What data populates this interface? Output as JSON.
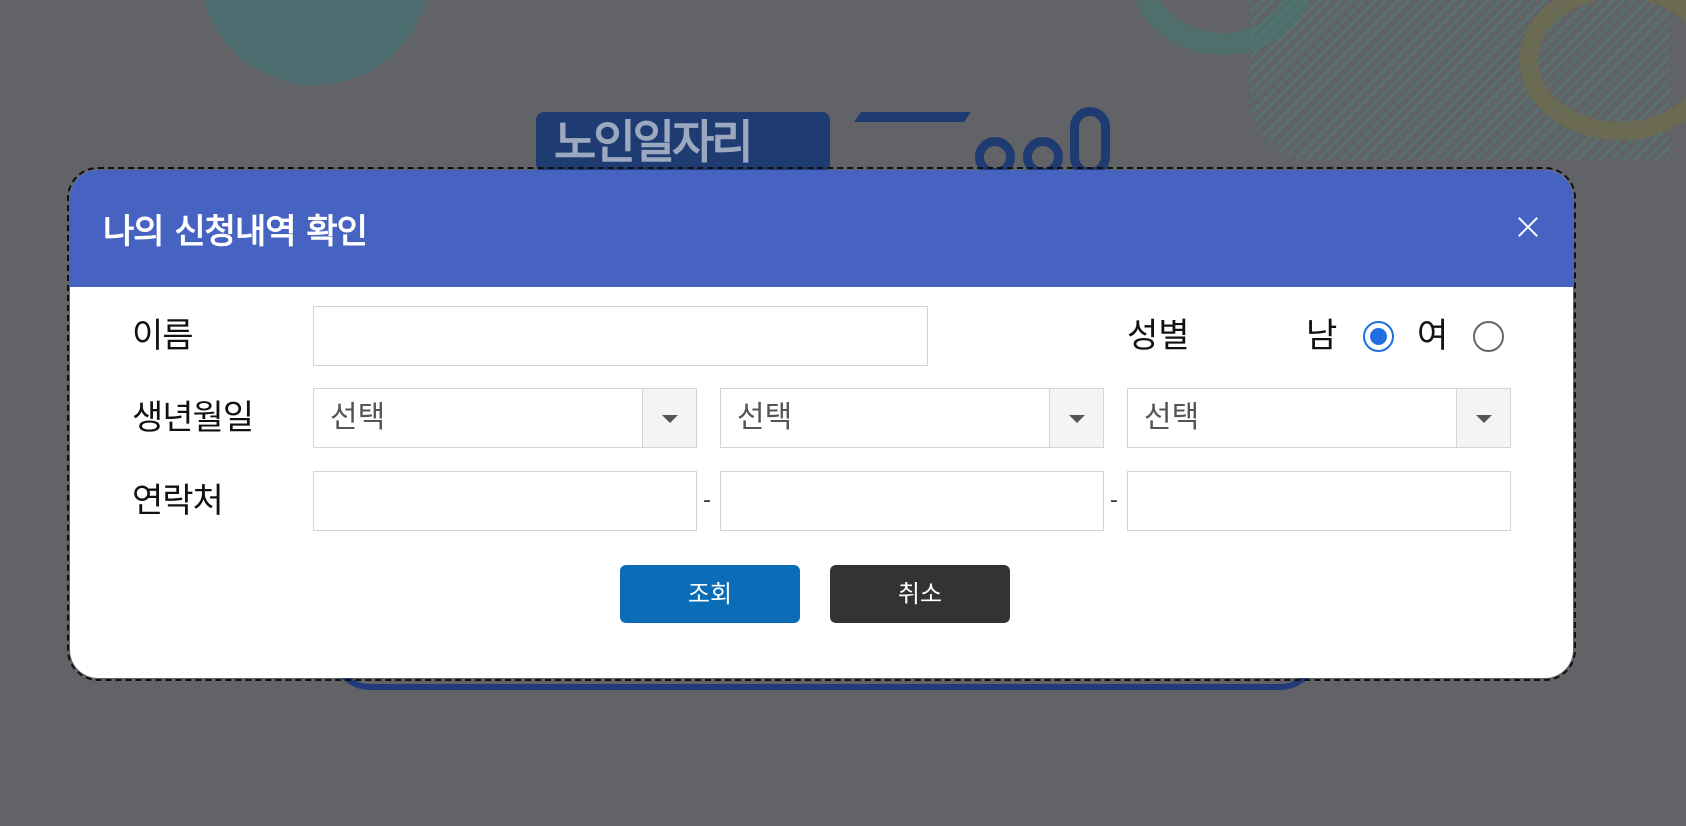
{
  "background": {
    "logo_text": "노인일자리"
  },
  "modal": {
    "title": "나의 신청내역 확인",
    "close_label": "닫기",
    "fields": {
      "name_label": "이름",
      "name_value": "",
      "gender_label": "성별",
      "gender_options": [
        {
          "label": "남",
          "checked": true
        },
        {
          "label": "여",
          "checked": false
        }
      ],
      "birth_label": "생년월일",
      "birth_selects": [
        {
          "value": "선택"
        },
        {
          "value": "선택"
        },
        {
          "value": "선택"
        }
      ],
      "phone_label": "연락처",
      "phone_values": [
        "",
        "",
        ""
      ],
      "phone_separator": "-"
    },
    "buttons": {
      "search_label": "조회",
      "cancel_label": "취소"
    }
  },
  "colors": {
    "header": "#4763c1",
    "search_button": "#0b6cb8",
    "cancel_button": "#333333",
    "radio_accent": "#1f6fe0"
  }
}
